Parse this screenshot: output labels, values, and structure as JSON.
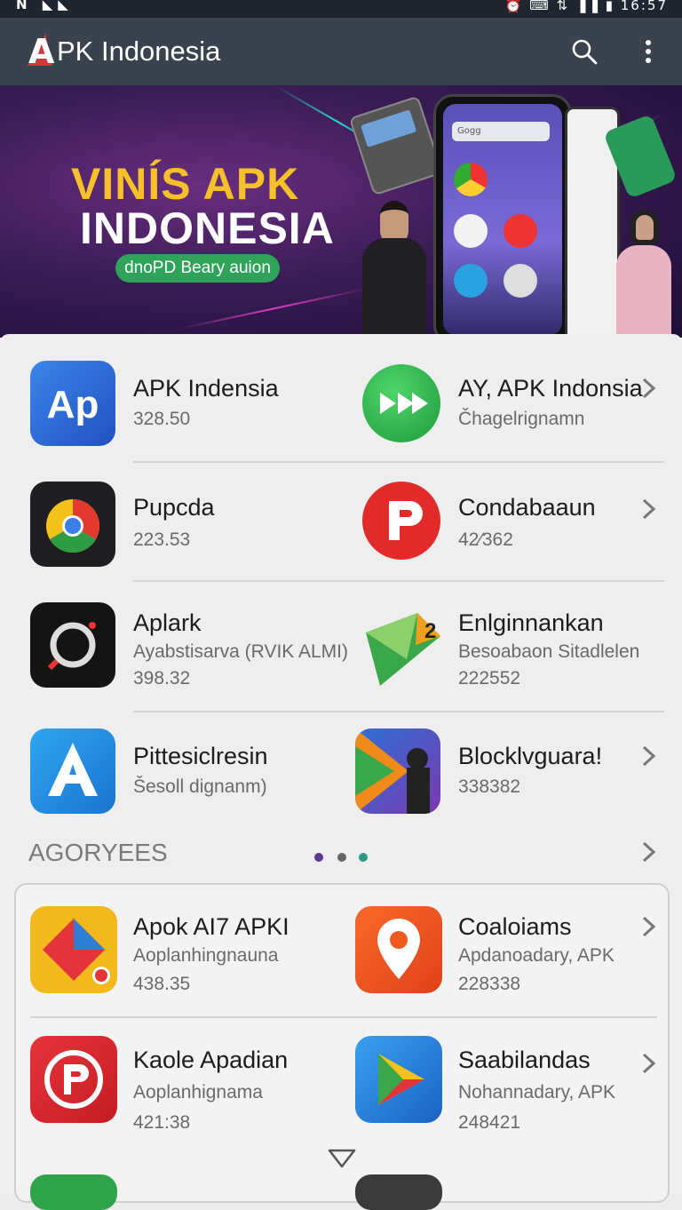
{
  "status_bar": {
    "left_icons": "N ◣◣",
    "right_text": "⏰ ⌨ ⇅ ▐▐ ▮ 16:57"
  },
  "app_bar": {
    "logo_mark": "A",
    "title": "PK Indonesia"
  },
  "banner": {
    "headline_1": "VINÍS APK",
    "headline_2": "INDONESIA",
    "pill": "dnoPD Beary auion",
    "phone_search": "Gogg"
  },
  "apps": [
    {
      "name": "APK Indensia",
      "line1": "328.50",
      "line2": "",
      "icon_color": "#2f6fd4",
      "icon_text": "Ap"
    },
    {
      "name": "AY, APK Indonsia",
      "line1": "Čhagelrignamn",
      "line2": "",
      "icon_color": "#2db04a",
      "icon_text": "▶▶"
    },
    {
      "name": "Pupcda",
      "line1": "223.53",
      "line2": "",
      "icon_color": "#1f1f22",
      "icon_text": ""
    },
    {
      "name": "Condabaaun",
      "line1": "42⁄362",
      "line2": "",
      "icon_color": "#e12b2b",
      "icon_text": "P"
    },
    {
      "name": "Aplark",
      "line1": "Ayabstisarva (RVIK ALMI)",
      "line2": "398.32",
      "icon_color": "#111111",
      "icon_text": ""
    },
    {
      "name": "Enlginnankan",
      "line1": "Besoabaon Sitadlelen",
      "line2": "222552",
      "icon_color": "#3aa84a",
      "icon_text": "2"
    },
    {
      "name": "Pittesiclresin",
      "line1": "Šesoll dignanm)",
      "line2": "",
      "icon_color": "#1e8ee0",
      "icon_text": "A"
    },
    {
      "name": "Blocklvguara!",
      "line1": "338382",
      "line2": "",
      "icon_color": "#f09a1a",
      "icon_text": ""
    }
  ],
  "section": {
    "title": "AGORYEES"
  },
  "dots_colors": [
    "#5a3a8a",
    "#666666",
    "#2a9a84"
  ],
  "section_apps": [
    {
      "name": "Apok AI7 APKI",
      "line1": "Aoplanhingnauna",
      "line2": "438.35",
      "icon_color": "#f3b81c"
    },
    {
      "name": "Coaloiams",
      "line1": "Apdanoadary, APK",
      "line2": "228338",
      "icon_color": "#f05a1e"
    },
    {
      "name": "Kaole Apadian",
      "line1": "Aoplanhignama",
      "line2": "421:38",
      "icon_color": "#d8262e"
    },
    {
      "name": "Saabilandas",
      "line1": "Nohannadary, APK",
      "line2": "248421",
      "icon_color": "#1f7fd8"
    }
  ]
}
